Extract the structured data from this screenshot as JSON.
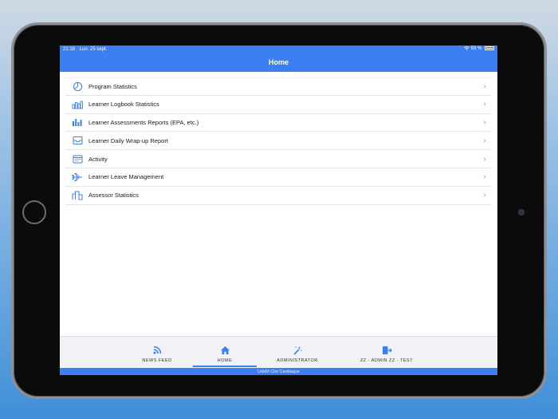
{
  "status": {
    "time": "21:18",
    "date": "Lun. 25 sept.",
    "battery": "93 %"
  },
  "nav": {
    "title": "Home"
  },
  "menu": [
    {
      "label": "Program Statistics",
      "icon": "pie-chart-icon"
    },
    {
      "label": "Learner Logbook Statistics",
      "icon": "bar-chart-icon"
    },
    {
      "label": "Learner Assessments Reports (EPA, etc.)",
      "icon": "bar-chart-icon"
    },
    {
      "label": "Learner Daily Wrap-up Report",
      "icon": "inbox-icon"
    },
    {
      "label": "Activity",
      "icon": "calendar-icon"
    },
    {
      "label": "Learner Leave Management",
      "icon": "plane-icon"
    },
    {
      "label": "Assessor Statistics",
      "icon": "columns-icon"
    }
  ],
  "tabs": [
    {
      "label": "NEWS FEED",
      "icon": "rss-icon"
    },
    {
      "label": "HOME",
      "icon": "home-icon"
    },
    {
      "label": "ADMINISTRATOR",
      "icon": "magic-wand-icon"
    },
    {
      "label": "ZZ - ADMIN ZZ - TEST",
      "icon": "exit-icon"
    }
  ],
  "footer": {
    "text": "UdeM Chx Cardiaque"
  },
  "colors": {
    "accent": "#3b7ff2"
  }
}
